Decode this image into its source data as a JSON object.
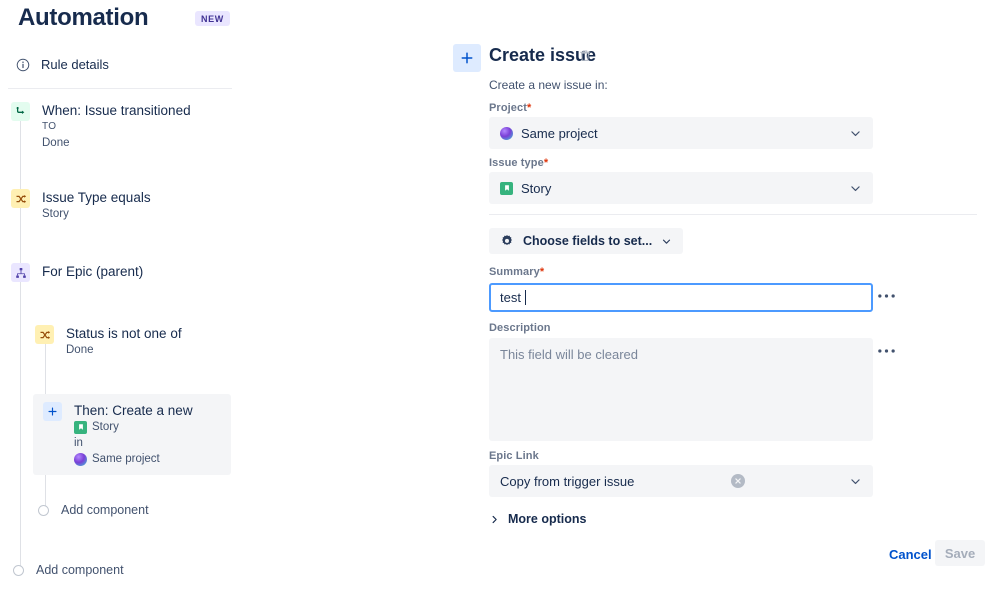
{
  "header": {
    "title": "Automation",
    "badge": "NEW"
  },
  "sidebar": {
    "rule_details": {
      "label": "Rule details",
      "icon": "info-circle-icon"
    },
    "nodes": [
      {
        "title": "When: Issue transitioned",
        "sub1": "TO",
        "sub2": "Done",
        "icon": "trigger-transition-icon",
        "chip_color": "#e3fcef"
      },
      {
        "title": "Issue Type equals",
        "sub1": "Story",
        "icon": "condition-compare-icon",
        "chip_color": "#fff0b3"
      },
      {
        "title": "For Epic (parent)",
        "icon": "branch-hierarchy-icon",
        "chip_color": "#eae6ff"
      },
      {
        "title": "Status is not one of",
        "sub1": "Done",
        "icon": "condition-compare-icon",
        "chip_color": "#fff0b3"
      }
    ],
    "action_node": {
      "title": "Then: Create a new",
      "issue_type": "Story",
      "connector": "in",
      "project": "Same project",
      "icon": "plus-icon"
    },
    "add_component_branch": "Add component",
    "add_component_root": "Add component"
  },
  "panel": {
    "title": "Create issue",
    "delete_icon": "trash-icon",
    "add_icon": "plus-icon",
    "subtitle": "Create a new issue in:",
    "project": {
      "label": "Project",
      "required": "*",
      "value": "Same project",
      "icon": "project-avatar-icon"
    },
    "issue_type": {
      "label": "Issue type",
      "required": "*",
      "value": "Story",
      "icon": "story-icon"
    },
    "choose_fields": {
      "label": "Choose fields to set...",
      "icon": "gear-icon"
    },
    "summary": {
      "label": "Summary",
      "required": "*",
      "value": "test",
      "menu_icon": "more-horizontal-icon"
    },
    "description": {
      "label": "Description",
      "placeholder": "This field will be cleared",
      "menu_icon": "more-horizontal-icon"
    },
    "epic_link": {
      "label": "Epic Link",
      "value": "Copy from trigger issue",
      "clear_icon": "clear-circle-icon",
      "chevron_icon": "chevron-down-icon"
    },
    "more_options": {
      "label": "More options",
      "icon": "chevron-right-icon"
    },
    "cancel_label": "Cancel",
    "save_label": "Save"
  },
  "colors": {
    "accent": "#0052cc",
    "focus_border": "#4c9aff",
    "required_red": "#de350b",
    "trigger_green": "#36b37e",
    "condition_yellow": "#ffab00",
    "branch_purple": "#6554c0",
    "badge_bg": "#eae6ff",
    "badge_fg": "#403294"
  }
}
